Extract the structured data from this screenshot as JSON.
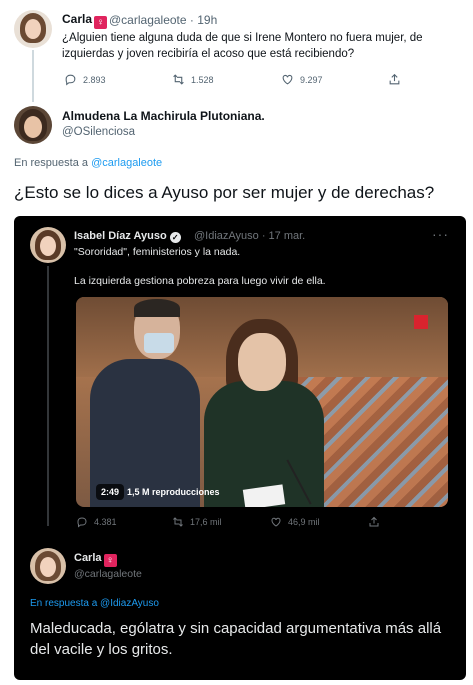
{
  "tweet1": {
    "name": "Carla",
    "badge": "♀",
    "handle": "@carlagaleote · 19h",
    "text": "¿Alguien tiene alguna duda de que si Irene Montero no fuera mujer, de izquierdas y joven recibiría el acoso que está recibiendo?",
    "replies": "2.893",
    "retweets": "1.528",
    "likes": "9.297"
  },
  "tweet2": {
    "name": "Almudena La Machirula Plutoniana.",
    "handle": "@OSilenciosa",
    "reply_prefix": "En respuesta a",
    "reply_to": "@carlagaleote",
    "text": "¿Esto se lo dices a Ayuso por ser mujer y de derechas?"
  },
  "embed": {
    "name": "Isabel Díaz Ayuso",
    "handle": "@IdiazAyuso · 17 mar.",
    "line1": "\"Sororidad\", feministerios y la nada.",
    "line2": "La izquierda gestiona pobreza para luego vivir de ella.",
    "video_time": "2:49",
    "video_views": "1,5 M reproducciones",
    "replies": "4.381",
    "retweets": "17,6 mil",
    "likes": "46,9 mil"
  },
  "embed_reply": {
    "name": "Carla",
    "badge": "♀",
    "handle": "@carlagaleote",
    "reply_prefix": "En respuesta a",
    "reply_to": "@IdiazAyuso",
    "text": "Maleducada, ególatra y sin capacidad argumentativa más allá del vacile y los gritos."
  },
  "colors": {
    "link": "#1d9bf0",
    "badge": "#e0245e",
    "dark_bg": "#000000"
  }
}
